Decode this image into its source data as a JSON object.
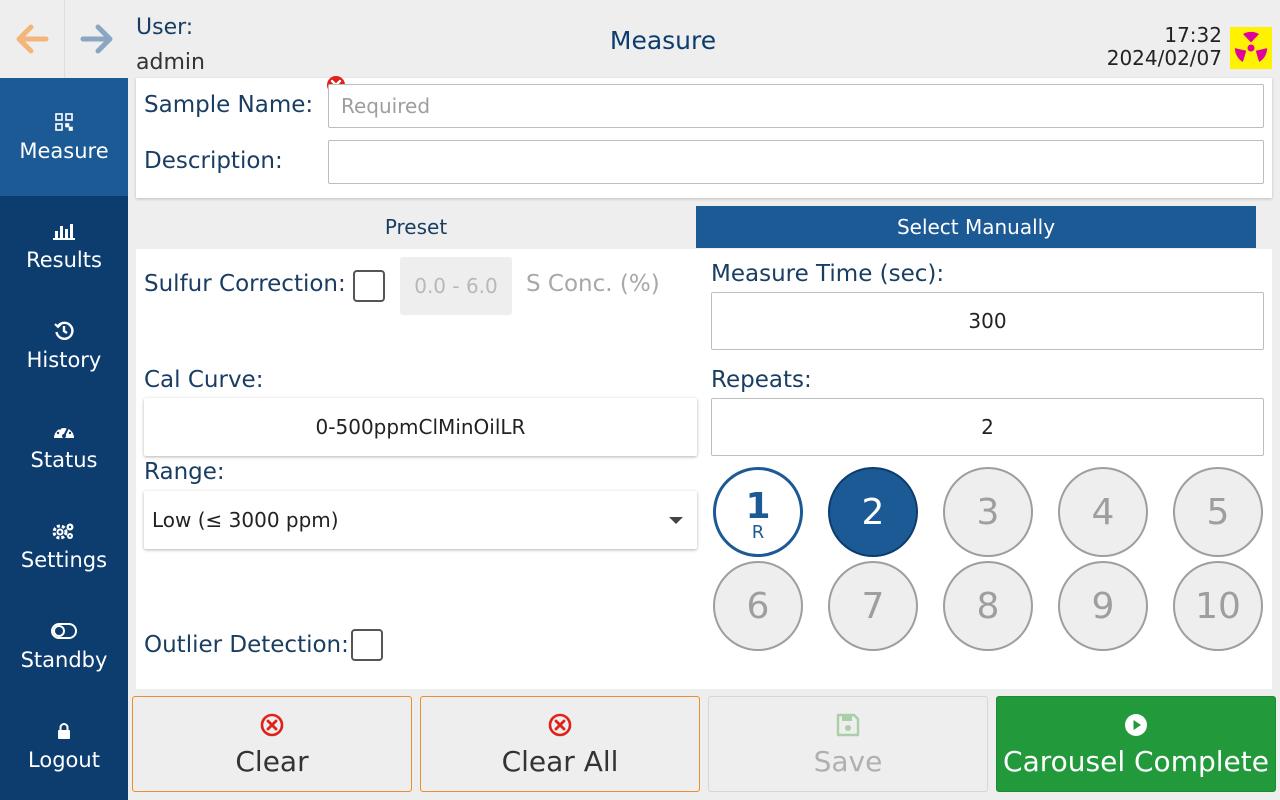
{
  "header": {
    "user_label": "User:",
    "username": "admin",
    "title": "Measure",
    "time": "17:32",
    "date": "2024/02/07"
  },
  "sidebar": {
    "items": [
      {
        "label": "Measure",
        "icon": "qr-code-icon",
        "active": true
      },
      {
        "label": "Results",
        "icon": "bar-chart-icon"
      },
      {
        "label": "History",
        "icon": "history-icon"
      },
      {
        "label": "Status",
        "icon": "gauge-icon"
      },
      {
        "label": "Settings",
        "icon": "gears-icon"
      },
      {
        "label": "Standby",
        "icon": "toggle-icon"
      },
      {
        "label": "Logout",
        "icon": "lock-icon"
      }
    ]
  },
  "sample": {
    "name_label": "Sample Name:",
    "name_placeholder": "Required",
    "name_value": "",
    "description_label": "Description:",
    "description_value": ""
  },
  "tabs": {
    "preset": "Preset",
    "manual": "Select Manually",
    "active": "manual"
  },
  "settings": {
    "sulfur_label": "Sulfur Correction:",
    "sulfur_checked": false,
    "sulfur_range_placeholder": "0.0 - 6.0",
    "s_conc_label": "S Conc. (%)",
    "cal_curve_label": "Cal Curve:",
    "cal_curve_value": "0-500ppmClMinOilLR",
    "range_label": "Range:",
    "range_value": "Low (≤ 3000 ppm)",
    "outlier_label": "Outlier Detection:",
    "outlier_checked": false,
    "measure_time_label": "Measure Time (sec):",
    "measure_time_value": "300",
    "repeats_label": "Repeats:",
    "repeats_value": "2"
  },
  "positions": {
    "items": [
      {
        "num": "1",
        "sub": "R",
        "state": "reference"
      },
      {
        "num": "2",
        "state": "selected"
      },
      {
        "num": "3",
        "state": "available"
      },
      {
        "num": "4",
        "state": "available"
      },
      {
        "num": "5",
        "state": "available"
      },
      {
        "num": "6",
        "state": "available"
      },
      {
        "num": "7",
        "state": "available"
      },
      {
        "num": "8",
        "state": "available"
      },
      {
        "num": "9",
        "state": "available"
      },
      {
        "num": "10",
        "state": "available"
      }
    ]
  },
  "actions": {
    "clear": "Clear",
    "clear_all": "Clear All",
    "save": "Save",
    "carousel_complete": "Carousel Complete"
  },
  "colors": {
    "navy": "#0d3c6e",
    "active_blue": "#1c5a96",
    "green": "#229a3c",
    "orange_border": "#e69138",
    "error_red": "#e0201a",
    "radiation_yellow": "#fff200",
    "radiation_magenta": "#e0009c"
  }
}
